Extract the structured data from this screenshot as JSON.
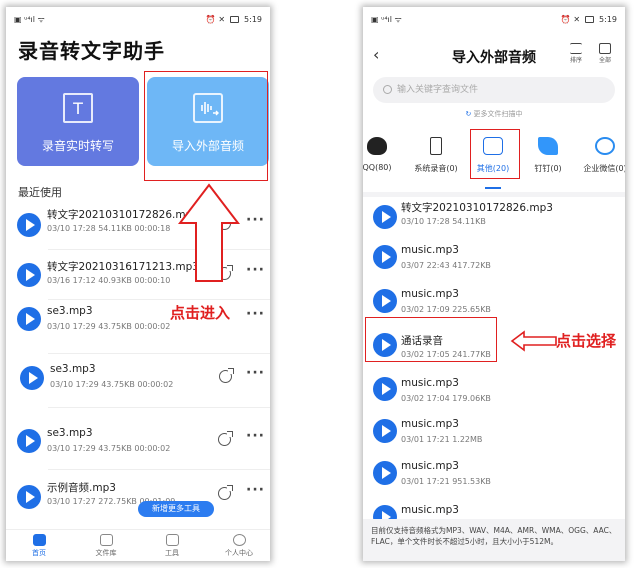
{
  "status": {
    "left_icons": "▣ ᵘ⁴ıl ᯤ",
    "right_icons": "⏰ ✕",
    "time": "5:19"
  },
  "left": {
    "title": "录音转文字助手",
    "card_record": "录音实时转写",
    "card_import": "导入外部音频",
    "section": "最近使用",
    "items": [
      {
        "name": "转文字20210310172826.mp3",
        "meta": "03/10 17:28  54.11KB  00:00:18"
      },
      {
        "name": "转文字20210316171213.mp3",
        "meta": "03/16 17:12  40.93KB  00:00:10"
      },
      {
        "name": "se3.mp3",
        "meta": "03/10 17:29  43.75KB  00:00:02"
      },
      {
        "name": "se3.mp3",
        "meta": "03/10 17:29  43.75KB  00:00:02"
      },
      {
        "name": "se3.mp3",
        "meta": "03/10 17:29  43.75KB  00:00:02"
      },
      {
        "name": "示例音频.mp3",
        "meta": "03/10 17:27  272.75KB  00:01:09"
      }
    ],
    "new_tools": "新增更多工具",
    "tabs": [
      "首页",
      "文件库",
      "工具",
      "个人中心"
    ],
    "annotation": "点击进入"
  },
  "right": {
    "title": "导入外部音频",
    "sort_label": "排序",
    "all_label": "全部",
    "search_placeholder": "输入关键字查询文件",
    "more_scan": "更多文件扫描中",
    "categories": [
      "QQ(80)",
      "系统录音(0)",
      "其他(20)",
      "钉钉(0)",
      "企业微信(0)"
    ],
    "files": [
      {
        "name": "转文字20210310172826.mp3",
        "meta": "03/10 17:28   54.11KB"
      },
      {
        "name": "music.mp3",
        "meta": "03/07 22:43   417.72KB"
      },
      {
        "name": "music.mp3",
        "meta": "03/02 17:09   225.65KB"
      },
      {
        "name": "通话录音",
        "meta": "03/02 17:05   241.77KB"
      },
      {
        "name": "music.mp3",
        "meta": "03/02 17:04   179.06KB"
      },
      {
        "name": "music.mp3",
        "meta": "03/01 17:21   1.22MB"
      },
      {
        "name": "music.mp3",
        "meta": "03/01 17:21   951.53KB"
      },
      {
        "name": "music.mp3",
        "meta": ""
      }
    ],
    "footnote": "目前仅支持音频格式为MP3、WAV、M4A、AMR、WMA、OGG、AAC、FLAC，单个文件时长不超过5小时，且大小小于512M。",
    "annotation": "点击选择"
  },
  "colors": {
    "accent": "#1f6fe6",
    "annotation": "#e02020",
    "card_record": "#6379e0",
    "card_import": "#6eb7f6"
  }
}
